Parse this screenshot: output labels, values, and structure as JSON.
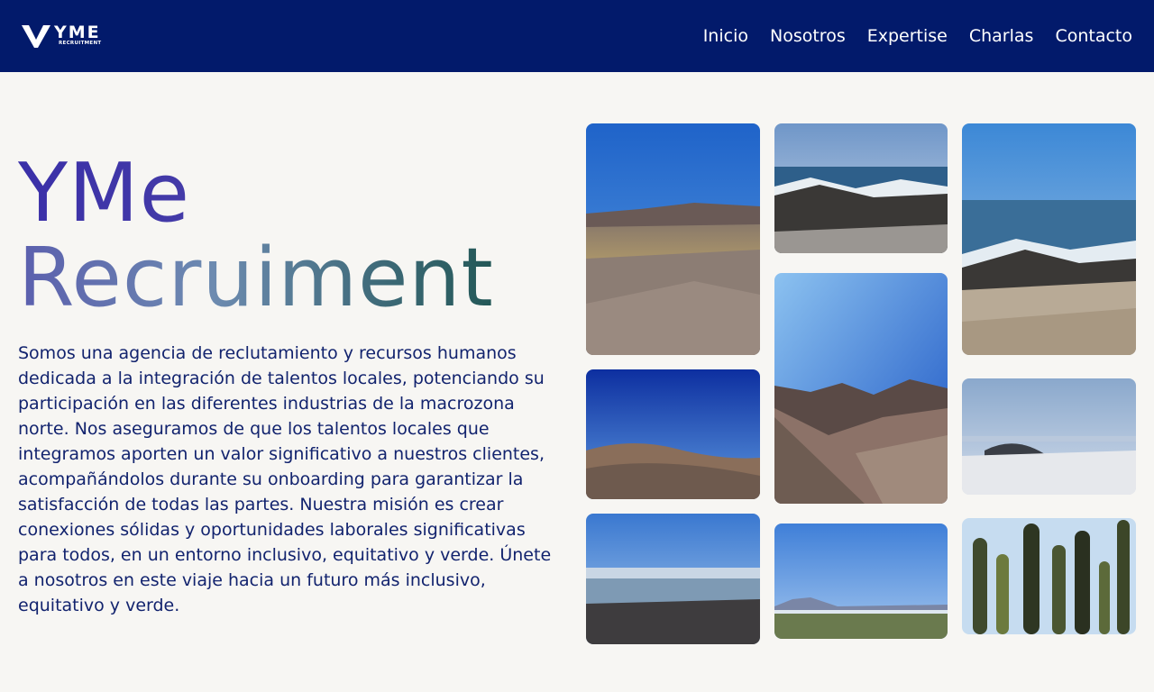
{
  "brand": {
    "logo_word": "YME",
    "logo_sub": "RECRUITMENT",
    "logo_icon": "yme-logo-icon"
  },
  "nav": {
    "items": [
      {
        "label": "Inicio"
      },
      {
        "label": "Nosotros"
      },
      {
        "label": "Expertise"
      },
      {
        "label": "Charlas"
      },
      {
        "label": "Contacto"
      }
    ]
  },
  "hero": {
    "title_line1": "YMe",
    "title_line2": "Recruiment",
    "description": "Somos una agencia de reclutamiento y recursos humanos dedicada a la integración de talentos locales, potenciando su participación en las diferentes industrias de la macrozona norte. Nos aseguramos de que los talentos locales que integramos aporten un valor significativo a nuestros clientes, acompañándolos durante su onboarding para garantizar la satisfacción de todas las partes. Nuestra misión es crear conexiones sólidas y oportunidades laborales significativas para todos, en un entorno inclusivo, equitativo y verde. Únete a nosotros en este viaje hacia un futuro más inclusivo, equitativo y verde."
  },
  "colors": {
    "nav_bg": "#021a6b",
    "page_bg": "#f7f6f3",
    "text_primary": "#12236e",
    "title_start": "#3a2fa8",
    "title_end": "#0f4a3e"
  }
}
